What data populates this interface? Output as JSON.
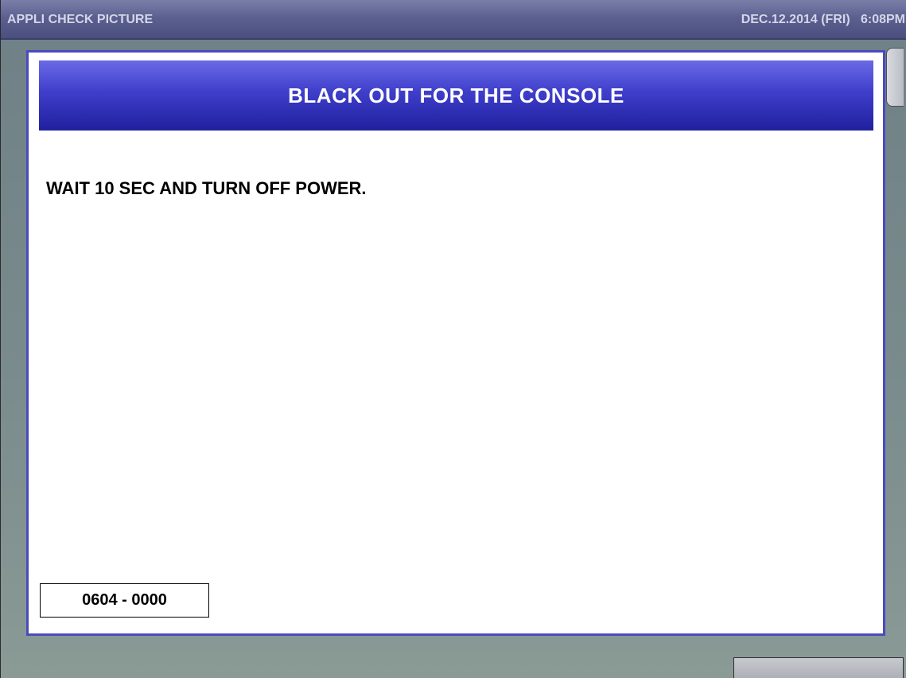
{
  "titlebar": {
    "app_title": "APPLI CHECK PICTURE",
    "datetime": "DEC.12.2014 (FRI)   6:08PM"
  },
  "dialog": {
    "title": "BLACK OUT FOR THE CONSOLE",
    "message": "WAIT 10 SEC AND TURN OFF POWER.",
    "code": "0604 - 0000"
  },
  "colors": {
    "titlebar": "#5c6090",
    "dialog_header": "#3e3ecb",
    "dialog_border": "#4a4ac0",
    "background": "#7a8b8d"
  }
}
